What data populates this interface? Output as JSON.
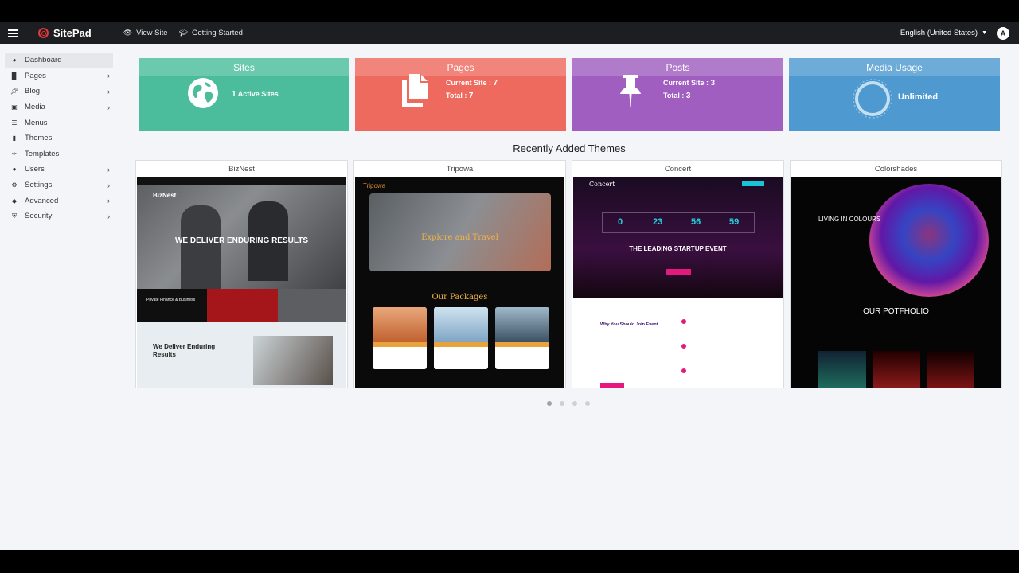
{
  "topbar": {
    "brand": "SitePad",
    "view_site": "View Site",
    "getting_started": "Getting Started",
    "language": "English (United States)",
    "avatar_letter": "A"
  },
  "sidebar": {
    "items": [
      {
        "label": "Dashboard",
        "icon": "dashboard-icon",
        "active": true,
        "has_submenu": false
      },
      {
        "label": "Pages",
        "icon": "pages-icon",
        "has_submenu": true
      },
      {
        "label": "Blog",
        "icon": "pin-icon",
        "has_submenu": true
      },
      {
        "label": "Media",
        "icon": "media-icon",
        "has_submenu": true
      },
      {
        "label": "Menus",
        "icon": "menus-icon",
        "has_submenu": false
      },
      {
        "label": "Themes",
        "icon": "themes-icon",
        "has_submenu": false
      },
      {
        "label": "Templates",
        "icon": "brush-icon",
        "has_submenu": false
      },
      {
        "label": "Users",
        "icon": "user-icon",
        "has_submenu": true
      },
      {
        "label": "Settings",
        "icon": "settings-icon",
        "has_submenu": true
      },
      {
        "label": "Advanced",
        "icon": "advanced-icon",
        "has_submenu": true
      },
      {
        "label": "Security",
        "icon": "shield-icon",
        "has_submenu": true
      }
    ]
  },
  "cards": {
    "sites": {
      "title": "Sites",
      "count": "1",
      "label": "Active Sites",
      "color": "#4bbd9c",
      "icon": "globe-icon"
    },
    "pages": {
      "title": "Pages",
      "current_label": "Current Site :",
      "current": "7",
      "total_label": "Total :",
      "total": "7",
      "color": "#ee6a5e",
      "icon": "copy-icon"
    },
    "posts": {
      "title": "Posts",
      "current_label": "Current Site :",
      "current": "3",
      "total_label": "Total :",
      "total": "3",
      "color": "#a05fc0",
      "icon": "pushpin-icon"
    },
    "media": {
      "title": "Media Usage",
      "value": "Unlimited",
      "color": "#4d99d0",
      "icon": "usage-ring-icon"
    }
  },
  "recent_themes": {
    "title": "Recently Added Themes",
    "themes": [
      {
        "name": "BizNest",
        "headline": "WE DELIVER ENDURING RESULTS",
        "sub": "Private Finance & Business"
      },
      {
        "name": "Tripowa",
        "headline": "Explore and Travel",
        "sub": "Our Packages"
      },
      {
        "name": "Concert",
        "headline": "THE LEADING STARTUP EVENT",
        "sub": "Why You Should Join Event",
        "countdown": [
          "0",
          "23",
          "56",
          "59"
        ]
      },
      {
        "name": "Colorshades",
        "headline": "LIVING IN COLOURS",
        "sub": "OUR POTFHOLIO"
      }
    ],
    "pagination": {
      "pages": 4,
      "current": 1
    }
  }
}
